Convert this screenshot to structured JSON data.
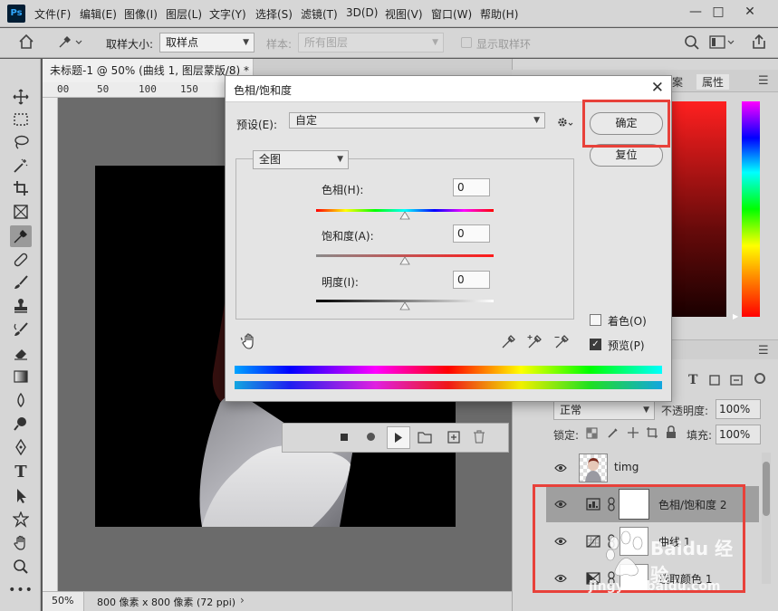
{
  "menu": {
    "items": [
      "文件(F)",
      "编辑(E)",
      "图像(I)",
      "图层(L)",
      "文字(Y)",
      "选择(S)",
      "滤镜(T)",
      "3D(D)",
      "视图(V)",
      "窗口(W)",
      "帮助(H)"
    ]
  },
  "app": {
    "logo_text": "Ps"
  },
  "options": {
    "sample_size_label": "取样大小:",
    "sample_size_value": "取样点",
    "sample_label": "样本:",
    "sample_value": "所有图层",
    "show_ring_label": "显示取样环"
  },
  "document": {
    "tab_title": "未标题-1 @ 50% (曲线 1, 图层蒙版/8) *",
    "ruler_marks": [
      "00",
      "50",
      "100",
      "150"
    ]
  },
  "status": {
    "zoom": "50%",
    "doc_info": "800 像素 x 800 像素 (72 ppi)"
  },
  "panels": {
    "color_tabs": [
      "案",
      "属性"
    ],
    "layers": {
      "blend_mode": "正常",
      "opacity_label": "不透明度:",
      "opacity_value": "100%",
      "lock_label": "锁定:",
      "fill_label": "填充:",
      "fill_value": "100%",
      "rows": [
        {
          "name": "timg"
        },
        {
          "name": "色相/饱和度 2"
        },
        {
          "name": "曲线 1"
        },
        {
          "name": "选取颜色 1"
        }
      ]
    }
  },
  "dialog": {
    "title": "色相/饱和度",
    "preset_label": "预设(E):",
    "preset_value": "自定",
    "channel_value": "全图",
    "hue_label": "色相(H):",
    "hue_value": "0",
    "saturation_label": "饱和度(A):",
    "saturation_value": "0",
    "lightness_label": "明度(I):",
    "lightness_value": "0",
    "ok_label": "确定",
    "reset_label": "复位",
    "colorize_label": "着色(O)",
    "colorize_checked": false,
    "preview_label": "预览(P)",
    "preview_checked": true
  },
  "watermark": {
    "text": "Baidu 经验",
    "url": "jingyan.baidu.com"
  },
  "colors": {
    "highlight": "#e8413a",
    "panel_bg": "#d6d6d6",
    "canvas_bg": "#6b6b6b",
    "selected_layer": "#9f9f9f"
  }
}
